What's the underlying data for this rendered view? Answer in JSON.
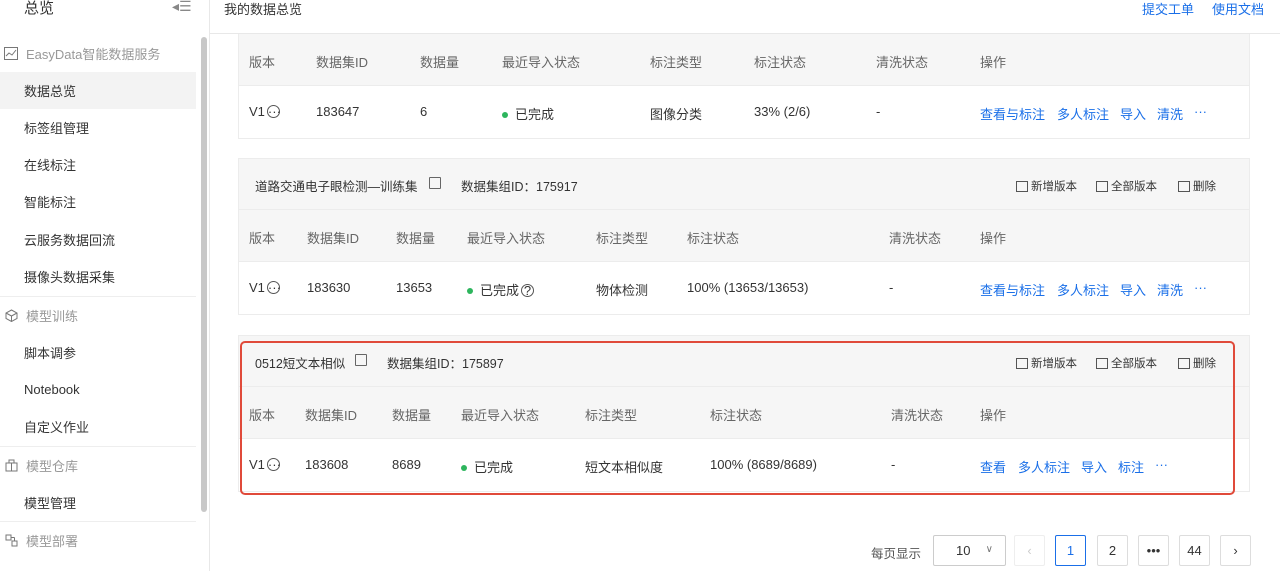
{
  "sidebar": {
    "title": "总览",
    "collapse_icon": "collapse-menu-icon",
    "groups": [
      {
        "label": "EasyData智能数据服务",
        "icon": "chart-icon",
        "items": [
          "数据总览",
          "标签组管理",
          "在线标注",
          "智能标注",
          "云服务数据回流",
          "摄像头数据采集"
        ]
      },
      {
        "label": "模型训练",
        "icon": "cube-icon",
        "items": [
          "脚本调参",
          "Notebook",
          "自定义作业"
        ]
      },
      {
        "label": "模型仓库",
        "icon": "warehouse-icon",
        "items": [
          "模型管理"
        ]
      },
      {
        "label": "模型部署",
        "icon": "deploy-icon",
        "items": []
      }
    ],
    "active_item": "数据总览"
  },
  "header": {
    "title": "我的数据总览",
    "links": [
      "提交工单",
      "使用文档"
    ]
  },
  "panel1": {
    "columns": [
      "版本",
      "数据集ID",
      "数据量",
      "最近导入状态",
      "标注类型",
      "标注状态",
      "清洗状态",
      "操作"
    ],
    "row": {
      "version": "V1",
      "dataset_id": "183647",
      "count": "6",
      "import_status": "已完成",
      "label_type": "图像分类",
      "label_status": "33% (2/6)",
      "clean_status": "-",
      "actions": [
        "查看与标注",
        "多人标注",
        "导入",
        "清洗",
        "···"
      ]
    }
  },
  "panel2": {
    "name": "道路交通电子眼检测—训练集",
    "group_id_label": "数据集组ID：175917",
    "head_actions": [
      "新增版本",
      "全部版本",
      "删除"
    ],
    "columns": [
      "版本",
      "数据集ID",
      "数据量",
      "最近导入状态",
      "标注类型",
      "标注状态",
      "清洗状态",
      "操作"
    ],
    "row": {
      "version": "V1",
      "dataset_id": "183630",
      "count": "13653",
      "import_status": "已完成",
      "label_type": "物体检测",
      "label_status": "100% (13653/13653)",
      "clean_status": "-",
      "actions": [
        "查看与标注",
        "多人标注",
        "导入",
        "清洗",
        "···"
      ]
    }
  },
  "panel3": {
    "name": "0512短文本相似",
    "group_id_label": "数据集组ID：175897",
    "head_actions": [
      "新增版本",
      "全部版本",
      "删除"
    ],
    "columns": [
      "版本",
      "数据集ID",
      "数据量",
      "最近导入状态",
      "标注类型",
      "标注状态",
      "清洗状态",
      "操作"
    ],
    "row": {
      "version": "V1",
      "dataset_id": "183608",
      "count": "8689",
      "import_status": "已完成",
      "label_type": "短文本相似度",
      "label_status": "100% (8689/8689)",
      "clean_status": "-",
      "actions": [
        "查看",
        "多人标注",
        "导入",
        "标注",
        "···"
      ]
    }
  },
  "pagination": {
    "per_page_label": "每页显示",
    "per_page_value": "10",
    "pages": [
      "1",
      "2",
      "•••",
      "44"
    ],
    "current": "1"
  },
  "colors": {
    "accent": "#1a6fe8",
    "success": "#2db55d",
    "highlight": "#e04a3a"
  }
}
